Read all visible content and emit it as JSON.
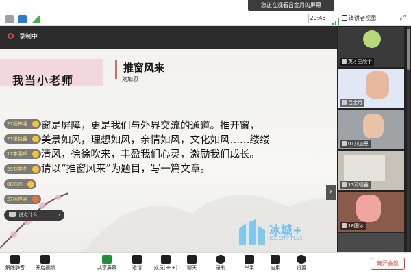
{
  "banner": "您正在观看吕金月的屏幕",
  "status": {
    "time": "20:43",
    "view_label": "演讲者视图"
  },
  "recording": {
    "label": "录制中"
  },
  "slide": {
    "header": "我当小老师",
    "title": "推窗风来",
    "author": "刘加忍",
    "body_lines": [
      "窗是屏障，更是我们与外界交流的通道。推开窗，",
      "美景如风，理想如风，亲情如风，文化如风……缕缕",
      "清风，徐徐吹来，丰盈我们心灵，激励我们成长。",
      "请以“推窗风来”为题目，写一篇文章。"
    ],
    "logo_main": "冰城+",
    "logo_sub": "ICE CITY PLUS"
  },
  "chat": {
    "items": [
      "27杨梓涵",
      "21张铭鑫",
      "17李明卓",
      "29刘奕冬",
      "08刘帅",
      "27杨梓涵"
    ],
    "input_placeholder": "说点什么..."
  },
  "participants": [
    {
      "name": "英才王欣宇"
    },
    {
      "name": "吕金月"
    },
    {
      "name": "01刘加恩"
    },
    {
      "name": "13邓德鑫"
    },
    {
      "name": "18国冰"
    }
  ],
  "toolbar": {
    "mute": "解除静音",
    "video": "开启视频",
    "share": "共享屏幕",
    "invite": "邀请",
    "members": "成员(99+)",
    "chat": "聊天",
    "record": "录制",
    "raise": "举手",
    "apps": "应用",
    "settings": "设置",
    "leave": "离开会议"
  },
  "colors": {
    "recording_red": "#e5484d",
    "slide_header_pink": "#f2d8dc",
    "logo_blue": "#6fc2f0",
    "leave_red": "#e23b3b",
    "chat_name_yellow": "#ffe27a"
  },
  "icons": {
    "tile_name_icon": "person-icon"
  }
}
